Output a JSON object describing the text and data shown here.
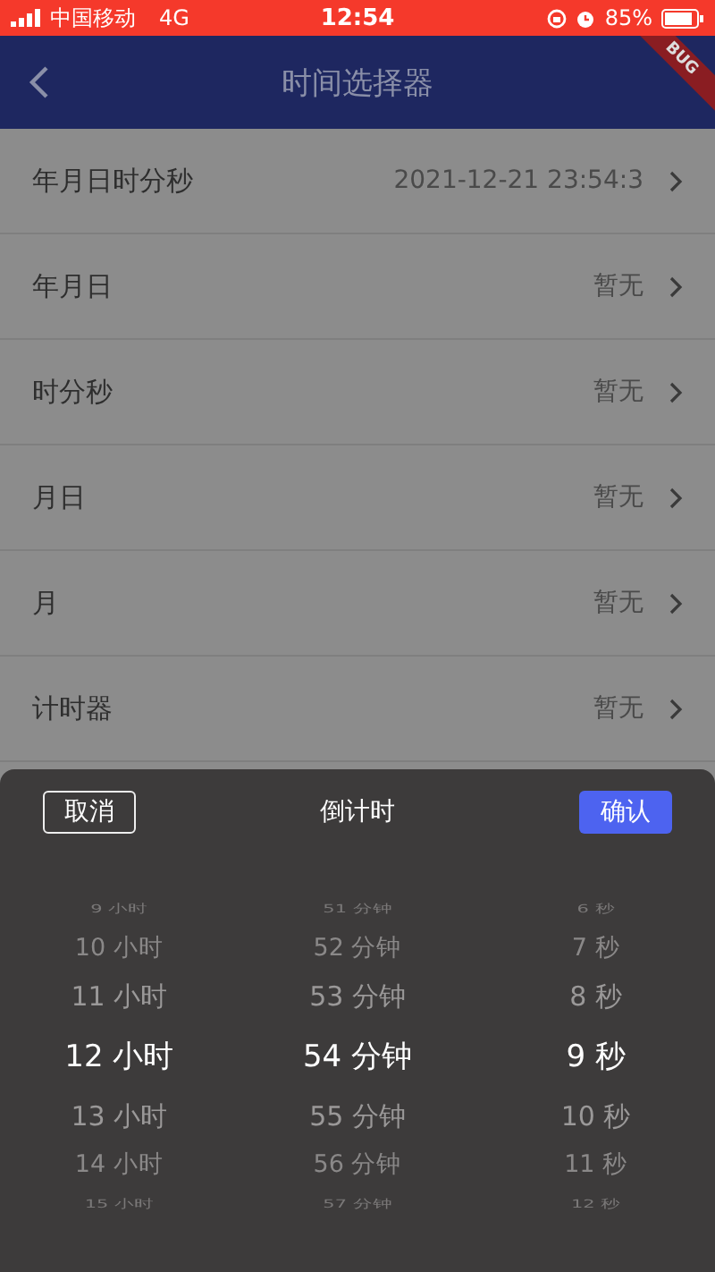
{
  "status_bar": {
    "carrier": "中国移动",
    "network": "4G",
    "time": "12:54",
    "battery": "85%"
  },
  "debug_banner": "BUG",
  "app_bar": {
    "title": "时间选择器"
  },
  "rows": [
    {
      "label": "年月日时分秒",
      "value": "2021-12-21 23:54:3"
    },
    {
      "label": "年月日",
      "value": "暂无"
    },
    {
      "label": "时分秒",
      "value": "暂无"
    },
    {
      "label": "月日",
      "value": "暂无"
    },
    {
      "label": "月",
      "value": "暂无"
    },
    {
      "label": "计时器",
      "value": "暂无"
    }
  ],
  "sheet": {
    "cancel": "取消",
    "title": "倒计时",
    "confirm": "确认",
    "columns": [
      {
        "items": [
          {
            "label": "9 小时",
            "selected": false
          },
          {
            "label": "10 小时",
            "selected": false
          },
          {
            "label": "11 小时",
            "selected": false
          },
          {
            "label": "12 小时",
            "selected": true
          },
          {
            "label": "13 小时",
            "selected": false
          },
          {
            "label": "14 小时",
            "selected": false
          },
          {
            "label": "15 小时",
            "selected": false
          }
        ]
      },
      {
        "items": [
          {
            "label": "51 分钟",
            "selected": false
          },
          {
            "label": "52 分钟",
            "selected": false
          },
          {
            "label": "53 分钟",
            "selected": false
          },
          {
            "label": "54 分钟",
            "selected": true
          },
          {
            "label": "55 分钟",
            "selected": false
          },
          {
            "label": "56 分钟",
            "selected": false
          },
          {
            "label": "57 分钟",
            "selected": false
          }
        ]
      },
      {
        "items": [
          {
            "label": "6 秒",
            "selected": false
          },
          {
            "label": "7 秒",
            "selected": false
          },
          {
            "label": "8 秒",
            "selected": false
          },
          {
            "label": "9 秒",
            "selected": true
          },
          {
            "label": "10 秒",
            "selected": false
          },
          {
            "label": "11 秒",
            "selected": false
          },
          {
            "label": "12 秒",
            "selected": false
          }
        ]
      }
    ]
  }
}
